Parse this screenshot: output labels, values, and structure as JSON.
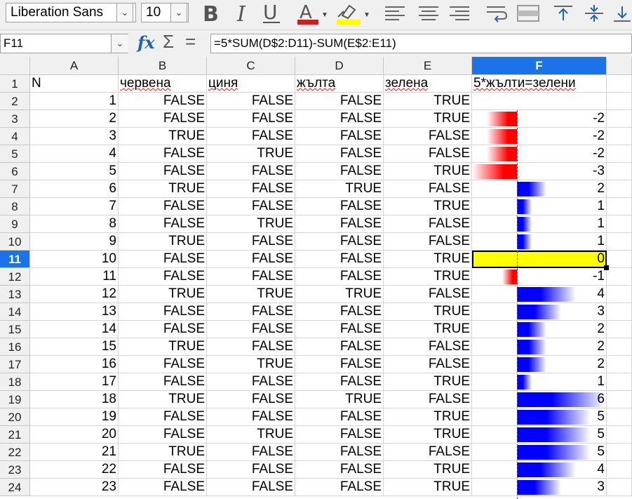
{
  "toolbar": {
    "font_name": "Liberation Sans",
    "font_size": "10",
    "font_color": "#c9211e",
    "highlight_color": "#ffff00"
  },
  "formula_bar": {
    "cell_ref": "F11",
    "formula": "=5*SUM(D$2:D11)-SUM(E$2:E11)"
  },
  "columns": [
    "A",
    "B",
    "C",
    "D",
    "E",
    "F"
  ],
  "selected_column": "F",
  "selected_row": "11",
  "header_row": [
    "N",
    "червена",
    "циня",
    "жълта",
    "зелена",
    "5*жълти=зелени"
  ],
  "rows": [
    {
      "row": "2",
      "n": "1",
      "b": "FALSE",
      "c": "FALSE",
      "d": "FALSE",
      "e": "TRUE",
      "f": ""
    },
    {
      "row": "3",
      "n": "2",
      "b": "FALSE",
      "c": "FALSE",
      "d": "FALSE",
      "e": "TRUE",
      "f": "-2"
    },
    {
      "row": "4",
      "n": "3",
      "b": "TRUE",
      "c": "FALSE",
      "d": "FALSE",
      "e": "FALSE",
      "f": "-2"
    },
    {
      "row": "5",
      "n": "4",
      "b": "FALSE",
      "c": "TRUE",
      "d": "FALSE",
      "e": "FALSE",
      "f": "-2"
    },
    {
      "row": "6",
      "n": "5",
      "b": "FALSE",
      "c": "FALSE",
      "d": "FALSE",
      "e": "TRUE",
      "f": "-3"
    },
    {
      "row": "7",
      "n": "6",
      "b": "TRUE",
      "c": "FALSE",
      "d": "TRUE",
      "e": "FALSE",
      "f": "2"
    },
    {
      "row": "8",
      "n": "7",
      "b": "FALSE",
      "c": "FALSE",
      "d": "FALSE",
      "e": "TRUE",
      "f": "1"
    },
    {
      "row": "9",
      "n": "8",
      "b": "FALSE",
      "c": "TRUE",
      "d": "FALSE",
      "e": "FALSE",
      "f": "1"
    },
    {
      "row": "10",
      "n": "9",
      "b": "TRUE",
      "c": "FALSE",
      "d": "FALSE",
      "e": "FALSE",
      "f": "1"
    },
    {
      "row": "11",
      "n": "10",
      "b": "FALSE",
      "c": "FALSE",
      "d": "FALSE",
      "e": "TRUE",
      "f": "0"
    },
    {
      "row": "12",
      "n": "11",
      "b": "FALSE",
      "c": "FALSE",
      "d": "FALSE",
      "e": "TRUE",
      "f": "-1"
    },
    {
      "row": "13",
      "n": "12",
      "b": "TRUE",
      "c": "TRUE",
      "d": "TRUE",
      "e": "FALSE",
      "f": "4"
    },
    {
      "row": "14",
      "n": "13",
      "b": "FALSE",
      "c": "FALSE",
      "d": "FALSE",
      "e": "TRUE",
      "f": "3"
    },
    {
      "row": "15",
      "n": "14",
      "b": "FALSE",
      "c": "FALSE",
      "d": "FALSE",
      "e": "TRUE",
      "f": "2"
    },
    {
      "row": "16",
      "n": "15",
      "b": "TRUE",
      "c": "FALSE",
      "d": "FALSE",
      "e": "FALSE",
      "f": "2"
    },
    {
      "row": "17",
      "n": "16",
      "b": "FALSE",
      "c": "TRUE",
      "d": "FALSE",
      "e": "FALSE",
      "f": "2"
    },
    {
      "row": "18",
      "n": "17",
      "b": "FALSE",
      "c": "FALSE",
      "d": "FALSE",
      "e": "TRUE",
      "f": "1"
    },
    {
      "row": "19",
      "n": "18",
      "b": "TRUE",
      "c": "FALSE",
      "d": "TRUE",
      "e": "FALSE",
      "f": "6"
    },
    {
      "row": "20",
      "n": "19",
      "b": "FALSE",
      "c": "FALSE",
      "d": "FALSE",
      "e": "TRUE",
      "f": "5"
    },
    {
      "row": "21",
      "n": "20",
      "b": "FALSE",
      "c": "TRUE",
      "d": "FALSE",
      "e": "TRUE",
      "f": "5"
    },
    {
      "row": "22",
      "n": "21",
      "b": "TRUE",
      "c": "FALSE",
      "d": "FALSE",
      "e": "FALSE",
      "f": "5"
    },
    {
      "row": "23",
      "n": "22",
      "b": "FALSE",
      "c": "FALSE",
      "d": "FALSE",
      "e": "TRUE",
      "f": "4"
    },
    {
      "row": "24",
      "n": "23",
      "b": "FALSE",
      "c": "FALSE",
      "d": "FALSE",
      "e": "TRUE",
      "f": "3"
    }
  ],
  "databar": {
    "positive_color": "#0000ff",
    "negative_color": "#ff0000",
    "max_abs": 6
  },
  "icons": [
    "bold-icon",
    "italic-icon",
    "underline-icon",
    "font-color-icon",
    "highlight-icon",
    "align-left-icon",
    "align-center-icon",
    "align-right-icon",
    "wrap-text-icon",
    "merge-cells-icon",
    "align-top-icon",
    "align-middle-icon",
    "align-bottom-icon",
    "function-wizard-icon",
    "sum-icon",
    "formula-icon"
  ]
}
